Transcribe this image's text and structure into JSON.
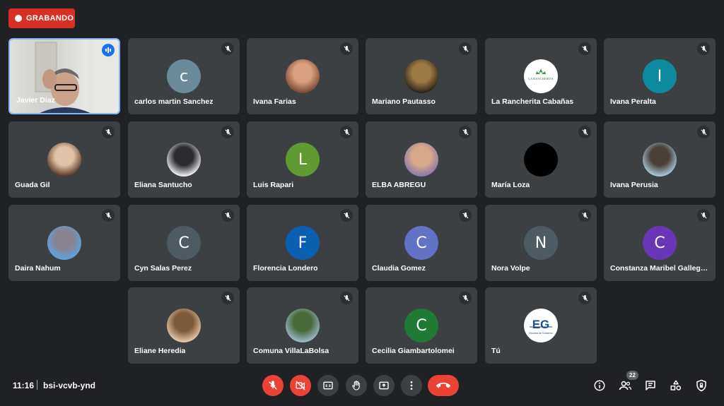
{
  "recording": {
    "label": "GRABANDO"
  },
  "participants": [
    {
      "name": "Javier Diaz",
      "type": "video"
    },
    {
      "name": "carlos martin Sanchez",
      "initial": "c",
      "color": "#6a8a98"
    },
    {
      "name": "Ivana Farias",
      "type": "photo",
      "colors": [
        "#7a4a36",
        "#d8a07e"
      ]
    },
    {
      "name": "Mariano Pautasso",
      "type": "photo",
      "colors": [
        "#2d2418",
        "#9c7a46"
      ]
    },
    {
      "name": "La Rancherita Cabañas",
      "type": "logo",
      "logo_text": "LA RANCHERITA"
    },
    {
      "name": "Ivana Peralta",
      "initial": "I",
      "color": "#0e8a9e"
    },
    {
      "name": "Guada Gil",
      "type": "photo",
      "colors": [
        "#5a3a2a",
        "#e2c2a6"
      ]
    },
    {
      "name": "Eliana Santucho",
      "type": "photo",
      "colors": [
        "#f0f0f0",
        "#2a2a30"
      ]
    },
    {
      "name": "Luis Rapari",
      "initial": "L",
      "color": "#5f9a32"
    },
    {
      "name": "ELBA ABREGU",
      "type": "photo",
      "colors": [
        "#8a7aa8",
        "#d8a888"
      ]
    },
    {
      "name": "María Loza",
      "type": "solid",
      "color": "#000000"
    },
    {
      "name": "Ivana Perusia",
      "type": "photo",
      "colors": [
        "#aac8dc",
        "#4a4038"
      ]
    },
    {
      "name": "Daira Nahum",
      "type": "photo",
      "colors": [
        "#5aa4e2",
        "#8a8290"
      ]
    },
    {
      "name": "Cyn Salas Perez",
      "initial": "C",
      "color": "#4f5b62"
    },
    {
      "name": "Florencia Londero",
      "initial": "F",
      "color": "#0b5fb0"
    },
    {
      "name": "Claudia Gomez",
      "initial": "C",
      "color": "#6272c4"
    },
    {
      "name": "Nora Volpe",
      "initial": "N",
      "color": "#4f5b62"
    },
    {
      "name": "Constanza Maribel Gallegos",
      "initial": "C",
      "color": "#6a36b8"
    },
    {
      "name": "Eliane Heredia",
      "type": "photo",
      "colors": [
        "#e8c8a8",
        "#7a5a3a"
      ]
    },
    {
      "name": "Comuna VillaLaBolsa",
      "type": "photo",
      "colors": [
        "#9cb8cc",
        "#4a6a3a"
      ]
    },
    {
      "name": "Cecilia Giambartolomei",
      "initial": "C",
      "color": "#1e7a34"
    },
    {
      "name": "Tú",
      "type": "logo2",
      "logo_text": "Escuela de Gobierno"
    }
  ],
  "bottom_bar": {
    "time": "11:16",
    "meeting_code": "bsi-vcvb-ynd",
    "controls": [
      "mic-off",
      "camera-off",
      "captions",
      "raise-hand",
      "present-screen",
      "more-options",
      "leave-call"
    ],
    "right_icons": [
      "info",
      "people",
      "chat",
      "activities",
      "host-controls"
    ],
    "people_count": "22"
  },
  "colors": {
    "background": "#202124",
    "tile": "#3c4043",
    "danger": "#ea4335",
    "accent": "#8ab4f8"
  }
}
